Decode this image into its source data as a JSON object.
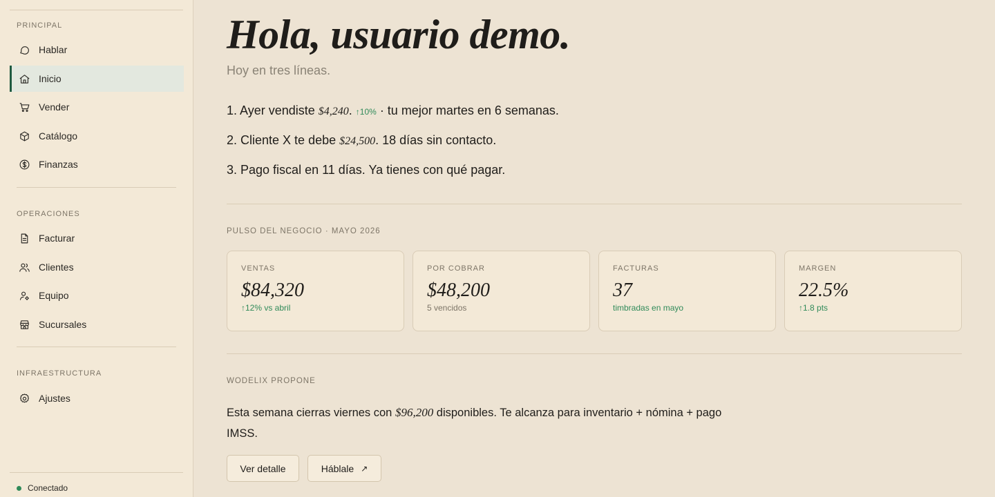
{
  "sidebar": {
    "sections": [
      {
        "label": "PRINCIPAL",
        "items": [
          {
            "label": "Hablar",
            "icon": "chat-icon"
          },
          {
            "label": "Inicio",
            "icon": "home-icon",
            "active": true
          },
          {
            "label": "Vender",
            "icon": "cart-icon"
          },
          {
            "label": "Catálogo",
            "icon": "box-icon"
          },
          {
            "label": "Finanzas",
            "icon": "dollar-icon"
          }
        ]
      },
      {
        "label": "OPERACIONES",
        "items": [
          {
            "label": "Facturar",
            "icon": "document-icon"
          },
          {
            "label": "Clientes",
            "icon": "users-icon"
          },
          {
            "label": "Equipo",
            "icon": "user-gear-icon"
          },
          {
            "label": "Sucursales",
            "icon": "store-icon"
          }
        ]
      },
      {
        "label": "INFRAESTRUCTURA",
        "items": [
          {
            "label": "Ajustes",
            "icon": "gear-icon"
          }
        ]
      }
    ],
    "status": {
      "label": "Conectado",
      "color": "#2f8a59"
    }
  },
  "header": {
    "title": "Hola, usuario demo.",
    "subtitle": "Hoy en tres líneas."
  },
  "summary": [
    {
      "prefix": "1. Ayer vendiste ",
      "amount": "$4,240",
      "mid": ".",
      "change": "↑10%",
      "suffix": " · tu mejor martes en 6 semanas."
    },
    {
      "prefix": "2. Cliente X te debe ",
      "amount": "$24,500",
      "suffix": ". 18 días sin contacto."
    },
    {
      "prefix": "3. Pago fiscal en 11 días. Ya tienes con qué pagar."
    }
  ],
  "pulse": {
    "label": "PULSO DEL NEGOCIO · MAYO 2026",
    "cards": [
      {
        "label": "VENTAS",
        "value": "$84,320",
        "sub": "↑12% vs abril",
        "tone": "green"
      },
      {
        "label": "POR COBRAR",
        "value": "$48,200",
        "sub": "5 vencidos",
        "tone": "muted"
      },
      {
        "label": "FACTURAS",
        "value": "37",
        "sub": "timbradas en mayo",
        "tone": "green"
      },
      {
        "label": "MARGEN",
        "value": "22.5%",
        "sub": "↑1.8 pts",
        "tone": "green"
      }
    ]
  },
  "proposal": {
    "label": "WODELIX PROPONE",
    "text_before": "Esta semana cierras viernes con ",
    "amount": "$96,200",
    "text_after": " disponibles. Te alcanza para inventario + nómina + pago IMSS.",
    "buttons": {
      "detail": "Ver detalle",
      "talk": "Háblale",
      "talk_icon": "↗"
    }
  },
  "colors": {
    "accent": "#1f5a40",
    "positive": "#2f8a59",
    "background": "#ede3d3",
    "sidebar": "#f3e9d7"
  }
}
